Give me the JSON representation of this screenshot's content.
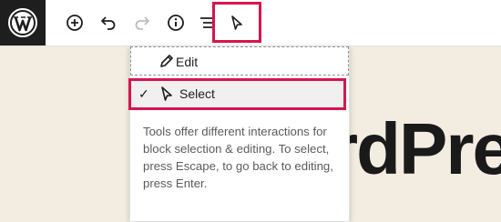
{
  "toolbar": {
    "logo_icon": "wordpress-logo-icon",
    "buttons": [
      {
        "icon": "add-block-icon"
      },
      {
        "icon": "undo-icon"
      },
      {
        "icon": "redo-icon"
      },
      {
        "icon": "info-icon"
      },
      {
        "icon": "list-view-icon"
      },
      {
        "icon": "select-tool-icon"
      }
    ]
  },
  "canvas": {
    "heading_fragment": "rdPre"
  },
  "tools_menu": {
    "items": [
      {
        "label": "Edit",
        "icon": "pencil-icon",
        "checked": false
      },
      {
        "label": "Select",
        "icon": "pointer-icon",
        "checked": true,
        "check_glyph": "✓"
      }
    ],
    "info_text": "Tools offer different interactions for block selection & editing. To select, press Escape, to go back to editing, press Enter."
  },
  "colors": {
    "highlight": "#d6154e",
    "toolbar_logo_bg": "#1e1e1e",
    "canvas_bg": "#f3ece0"
  }
}
